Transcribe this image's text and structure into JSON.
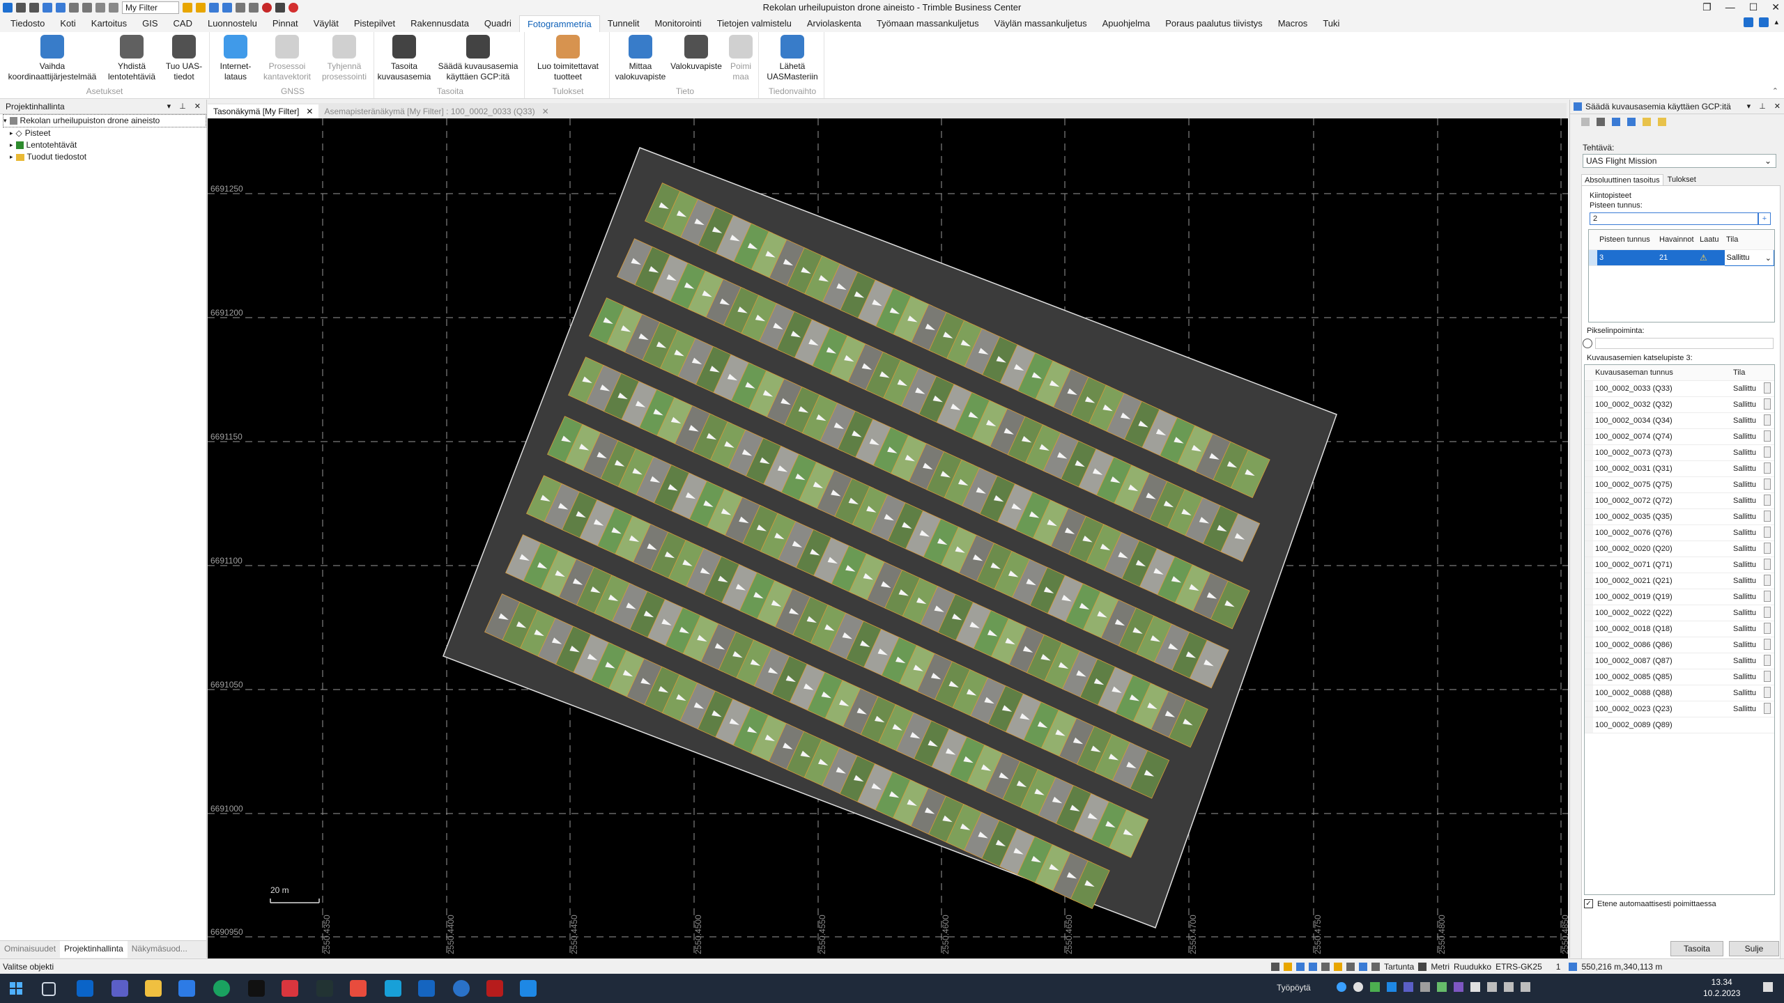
{
  "app": {
    "title": "Rekolan urheilupuiston drone aineisto - Trimble Business Center",
    "filter_value": "My Filter"
  },
  "menu": {
    "tabs": [
      "Tiedosto",
      "Koti",
      "Kartoitus",
      "GIS",
      "CAD",
      "Luonnostelu",
      "Pinnat",
      "Väylät",
      "Pistepilvet",
      "Rakennusdata",
      "Quadri",
      "Fotogrammetria",
      "Tunnelit",
      "Monitorointi",
      "Tietojen valmistelu",
      "Arviolaskenta",
      "Työmaan massankuljetus",
      "Väylän massankuljetus",
      "Apuohjelma",
      "Poraus paalutus tiivistys",
      "Macros",
      "Tuki"
    ],
    "active": "Fotogrammetria"
  },
  "ribbon": {
    "groups": [
      {
        "label": "Asetukset",
        "buttons": [
          {
            "label": "Vaihda\nkoordinaattijärjestelmää",
            "icon": "globe-icon",
            "enabled": true
          },
          {
            "label": "Yhdistä\nlentotehtäviä",
            "icon": "merge-flights-icon",
            "enabled": true
          },
          {
            "label": "Tuo UAS-\ntiedot",
            "icon": "drone-import-icon",
            "enabled": true
          }
        ]
      },
      {
        "label": "GNSS",
        "buttons": [
          {
            "label": "Internet-\nlataus",
            "icon": "internet-download-icon",
            "enabled": true
          },
          {
            "label": "Prosessoi\nkantavektorit",
            "icon": "baseline-process-icon",
            "enabled": false
          },
          {
            "label": "Tyhjennä\nprosessointi",
            "icon": "clear-process-icon",
            "enabled": false
          }
        ]
      },
      {
        "label": "Tasoita",
        "buttons": [
          {
            "label": "Tasoita\nkuvausasemia",
            "icon": "adjust-stations-icon",
            "enabled": true
          },
          {
            "label": "Säädä kuvausasemia\nkäyttäen GCP:itä",
            "icon": "adjust-gcp-icon",
            "enabled": true
          }
        ]
      },
      {
        "label": "Tulokset",
        "buttons": [
          {
            "label": "Luo toimitettavat\ntuotteet",
            "icon": "deliverables-icon",
            "enabled": true
          }
        ]
      },
      {
        "label": "Tieto",
        "buttons": [
          {
            "label": "Mittaa\nvalokuvapiste",
            "icon": "measure-photo-point-icon",
            "enabled": true
          },
          {
            "label": "Valokuvapiste",
            "icon": "photo-point-icon",
            "enabled": true
          },
          {
            "label": "Poimi\nmaa",
            "icon": "pick-ground-icon",
            "enabled": false
          }
        ]
      },
      {
        "label": "Tiedonvaihto",
        "buttons": [
          {
            "label": "Lähetä\nUASMasteriin",
            "icon": "send-uasmaster-icon",
            "enabled": true
          }
        ]
      }
    ]
  },
  "project_panel": {
    "title": "Projektinhallinta",
    "root": "Rekolan urheilupuiston drone aineisto",
    "items": [
      {
        "label": "Pisteet",
        "icon": "points-icon"
      },
      {
        "label": "Lentotehtävät",
        "icon": "flight-tasks-icon"
      },
      {
        "label": "Tuodut tiedostot",
        "icon": "folder-icon"
      }
    ],
    "bottom_tabs": [
      "Ominaisuudet",
      "Projektinhallinta",
      "Näkymäsuod..."
    ]
  },
  "doc_tabs": [
    {
      "label": "Tasonäkymä [My Filter]",
      "active": true
    },
    {
      "label": "Asemapisteränäkymä [My Filter] : 100_0002_0033 (Q33)",
      "active": false
    }
  ],
  "viewport": {
    "northing_labels": [
      "6691250",
      "6691200",
      "6691150",
      "6691100",
      "6691050",
      "6691000",
      "6690950"
    ],
    "easting_labels": [
      "2550.4350",
      "2550.4400",
      "2550.4450",
      "2550.4500",
      "2550.4550",
      "2550.4600",
      "2550.4650",
      "2550.4700",
      "2550.4750",
      "2550.4800",
      "2550.4850"
    ],
    "scale_label": "20 m"
  },
  "right_panel": {
    "title": "Säädä kuvausasemia käyttäen GCP:itä",
    "task_label": "Tehtävä:",
    "task_value": "UAS Flight Mission",
    "tabs": [
      "Absoluuttinen tasoitus",
      "Tulokset"
    ],
    "control_label": "Kiintopisteet",
    "point_id_label": "Pisteen tunnus:",
    "point_id_value": "2",
    "points_table": {
      "headers": [
        "Pisteen tunnus",
        "Havainnot",
        "Laatu",
        "Tila"
      ],
      "rows": [
        {
          "id": "3",
          "obs": "21",
          "quality": "warning-icon",
          "status": "Sallittu"
        }
      ]
    },
    "pixel_pick_label": "Pikselinpoiminta:",
    "stations_label": "Kuvausasemien katselupiste 3:",
    "stations_headers": [
      "Kuvausaseman tunnus",
      "Tila"
    ],
    "stations": [
      {
        "id": "100_0002_0033 (Q33)",
        "status": "Sallittu"
      },
      {
        "id": "100_0002_0032 (Q32)",
        "status": "Sallittu"
      },
      {
        "id": "100_0002_0034 (Q34)",
        "status": "Sallittu"
      },
      {
        "id": "100_0002_0074 (Q74)",
        "status": "Sallittu"
      },
      {
        "id": "100_0002_0073 (Q73)",
        "status": "Sallittu"
      },
      {
        "id": "100_0002_0031 (Q31)",
        "status": "Sallittu"
      },
      {
        "id": "100_0002_0075 (Q75)",
        "status": "Sallittu"
      },
      {
        "id": "100_0002_0072 (Q72)",
        "status": "Sallittu"
      },
      {
        "id": "100_0002_0035 (Q35)",
        "status": "Sallittu"
      },
      {
        "id": "100_0002_0076 (Q76)",
        "status": "Sallittu"
      },
      {
        "id": "100_0002_0020 (Q20)",
        "status": "Sallittu"
      },
      {
        "id": "100_0002_0071 (Q71)",
        "status": "Sallittu"
      },
      {
        "id": "100_0002_0021 (Q21)",
        "status": "Sallittu"
      },
      {
        "id": "100_0002_0019 (Q19)",
        "status": "Sallittu"
      },
      {
        "id": "100_0002_0022 (Q22)",
        "status": "Sallittu"
      },
      {
        "id": "100_0002_0018 (Q18)",
        "status": "Sallittu"
      },
      {
        "id": "100_0002_0086 (Q86)",
        "status": "Sallittu"
      },
      {
        "id": "100_0002_0087 (Q87)",
        "status": "Sallittu"
      },
      {
        "id": "100_0002_0085 (Q85)",
        "status": "Sallittu"
      },
      {
        "id": "100_0002_0088 (Q88)",
        "status": "Sallittu"
      },
      {
        "id": "100_0002_0023 (Q23)",
        "status": "Sallittu"
      },
      {
        "id": "100_0002_0089 (Q89)",
        "status": ""
      }
    ],
    "auto_checkbox_label": "Etene automaattisesti poimittaessa",
    "auto_checked": true,
    "adjust_button": "Tasoita",
    "close_button": "Sulje"
  },
  "status_bar": {
    "left": "Valitse objekti",
    "snap": "Tartunta",
    "unit": "Metri",
    "grid": "Ruudukko",
    "crs": "ETRS-GK25",
    "number": "1",
    "coords": "550,216 m,340,113 m"
  },
  "taskbar": {
    "desk_label": "Työpöytä",
    "time": "13.34",
    "date": "10.2.2023"
  }
}
